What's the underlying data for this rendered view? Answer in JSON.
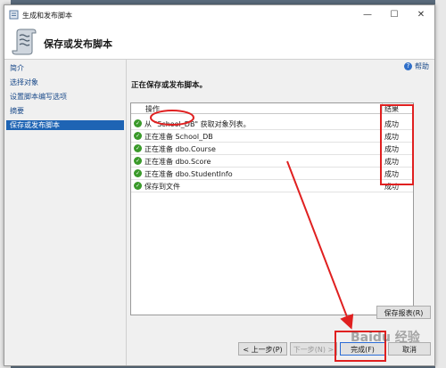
{
  "window": {
    "title": "生成和发布脚本",
    "minimize": "—",
    "maximize": "☐",
    "close": "✕"
  },
  "header": {
    "title": "保存或发布脚本"
  },
  "nav": {
    "items": [
      "简介",
      "选择对象",
      "设置脚本编写选项",
      "摘要",
      "保存或发布脚本"
    ],
    "active_index": 4
  },
  "help": {
    "label": "帮助"
  },
  "section_title": "正在保存或发布脚本。",
  "grid": {
    "columns": [
      "操作",
      "结果"
    ],
    "rows": [
      {
        "action": "从 \"School_DB\" 获取对象列表。",
        "result": "成功"
      },
      {
        "action": "正在准备 School_DB",
        "result": "成功"
      },
      {
        "action": "正在准备 dbo.Course",
        "result": "成功"
      },
      {
        "action": "正在准备 dbo.Score",
        "result": "成功"
      },
      {
        "action": "正在准备 dbo.StudentInfo",
        "result": "成功"
      },
      {
        "action": "保存到文件",
        "result": "成功"
      }
    ]
  },
  "buttons": {
    "save_report": "保存报表(R)",
    "prev": "< 上一步(P)",
    "next": "下一步(N) >",
    "finish": "完成(F)",
    "cancel": "取消"
  },
  "watermark": "Baidu 经验",
  "colors": {
    "accent": "#1e64b4",
    "annotation": "#e02020",
    "success": "#3a9a2a"
  }
}
